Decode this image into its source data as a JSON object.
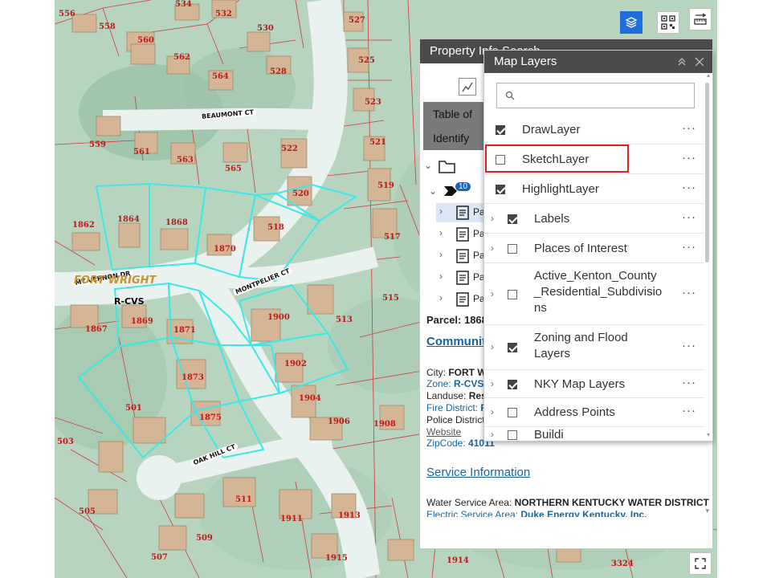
{
  "map": {
    "parcel_numbers": [
      "556",
      "558",
      "534",
      "532",
      "530",
      "527",
      "560",
      "562",
      "564",
      "528",
      "525",
      "523",
      "559",
      "561",
      "563",
      "565",
      "522",
      "521",
      "520",
      "519",
      "1862",
      "1864",
      "1868",
      "1870",
      "518",
      "517",
      "1867",
      "1869",
      "1871",
      "1900",
      "513",
      "515",
      "1873",
      "1902",
      "1904",
      "1875",
      "1906",
      "1908",
      "501",
      "503",
      "505",
      "511",
      "1911",
      "1913",
      "509",
      "1915",
      "507",
      "1914",
      "3324"
    ],
    "street_labels": [
      "BEAUMONT CT",
      "MONTPELIER CT",
      "MT VERNON DR",
      "OAK HILL CT"
    ],
    "place_label": "FORT WRIGHT",
    "zone_label": "R-CVS",
    "toolbar": {
      "layers_icon": "layers-icon",
      "qr_icon": "qr-icon",
      "measure_icon": "measure-icon",
      "fullscreen_icon": "fullscreen-icon"
    }
  },
  "property_panel": {
    "title": "Property Info Search",
    "tab_table": "Table of Co",
    "tab_identify": "Identify",
    "badge_count": "10",
    "tree_items": [
      "Pa",
      "Pa",
      "Pa",
      "Pa",
      "Pa"
    ],
    "parcel_line": "Parcel: 1868",
    "community_heading": "Communit",
    "city_label": "City:",
    "city_value": "FORT W",
    "zone_label": "Zone:",
    "zone_value": "R-CVS",
    "landuse_label": "Landuse:",
    "landuse_value": "Resi",
    "fire_label": "Fire District:",
    "fire_value": "F",
    "police_label": "Police District",
    "website": "Website",
    "zip_label": "ZipCode:",
    "zip_value": "41011",
    "service_heading": "Service Information",
    "water_label": "Water Service Area:",
    "water_value": "NORTHERN KENTUCKY WATER DISTRICT",
    "electric_label": "Electric Service Area:",
    "electric_value": "Duke Energy Kentucky, Inc."
  },
  "layers_panel": {
    "title": "Map Layers",
    "search_placeholder": "",
    "layers": [
      {
        "label": "DrawLayer",
        "checked": true,
        "expandable": false
      },
      {
        "label": "SketchLayer",
        "checked": false,
        "expandable": false
      },
      {
        "label": "HighlightLayer",
        "checked": true,
        "expandable": false
      },
      {
        "label": "Labels",
        "checked": true,
        "expandable": true
      },
      {
        "label": "Places of Interest",
        "checked": false,
        "expandable": true
      },
      {
        "label": "Active_Kenton_County _Residential_Subdivisio ns",
        "checked": false,
        "expandable": true
      },
      {
        "label": "Zoning and Flood Layers",
        "checked": true,
        "expandable": true
      },
      {
        "label": "NKY Map Layers",
        "checked": true,
        "expandable": true
      },
      {
        "label": "Address Points",
        "checked": false,
        "expandable": true
      },
      {
        "label": "Buildi",
        "checked": false,
        "expandable": true
      }
    ],
    "more_glyph": "···"
  }
}
